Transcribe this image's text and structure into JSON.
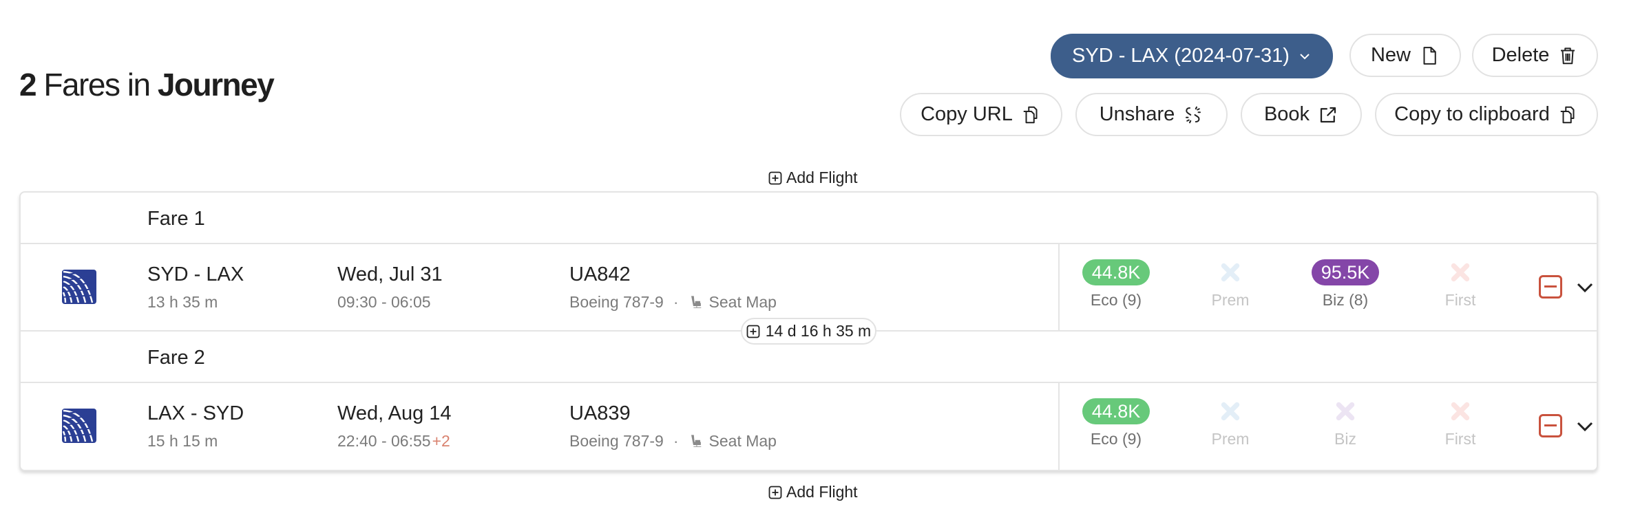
{
  "header": {
    "title_count": "2",
    "title_middle": "Fares in",
    "title_end": "Journey"
  },
  "toolbar": {
    "journey_select": "SYD - LAX (2024-07-31)",
    "new_label": "New",
    "delete_label": "Delete",
    "copy_url_label": "Copy URL",
    "unshare_label": "Unshare",
    "book_label": "Book",
    "copy_clipboard_label": "Copy to clipboard"
  },
  "add_flight_label": "Add Flight",
  "layover": "14 d 16 h 35 m",
  "colors": {
    "primary": "#3d5e8b",
    "eco": "#67c97a",
    "biz": "#8446a8",
    "remove": "#c9523d",
    "prem_unavailable": "#e3eef7",
    "biz_unavailable": "#ece4f3",
    "first_unavailable": "#fbe4e2",
    "airline_logo": "#2b3f94"
  },
  "fares": [
    {
      "label": "Fare 1",
      "flight": {
        "airline_icon": "united-airlines-globe-icon",
        "route": "SYD - LAX",
        "duration": "13 h 35 m",
        "date": "Wed, Jul 31",
        "times": "09:30 - 06:05",
        "day_offset": "",
        "flight_number": "UA842",
        "aircraft": "Boeing 787-9",
        "separator": "·",
        "seat_map_label": "Seat Map",
        "cabins": [
          {
            "name": "Eco (9)",
            "price": "44.8K",
            "available": true
          },
          {
            "name": "Prem",
            "price": "",
            "available": false
          },
          {
            "name": "Biz (8)",
            "price": "95.5K",
            "available": true
          },
          {
            "name": "First",
            "price": "",
            "available": false
          }
        ]
      }
    },
    {
      "label": "Fare 2",
      "flight": {
        "airline_icon": "united-airlines-globe-icon",
        "route": "LAX - SYD",
        "duration": "15 h 15 m",
        "date": "Wed, Aug 14",
        "times": "22:40 - 06:55",
        "day_offset": "+2",
        "flight_number": "UA839",
        "aircraft": "Boeing 787-9",
        "separator": "·",
        "seat_map_label": "Seat Map",
        "cabins": [
          {
            "name": "Eco (9)",
            "price": "44.8K",
            "available": true
          },
          {
            "name": "Prem",
            "price": "",
            "available": false
          },
          {
            "name": "Biz",
            "price": "",
            "available": false
          },
          {
            "name": "First",
            "price": "",
            "available": false
          }
        ]
      }
    }
  ]
}
